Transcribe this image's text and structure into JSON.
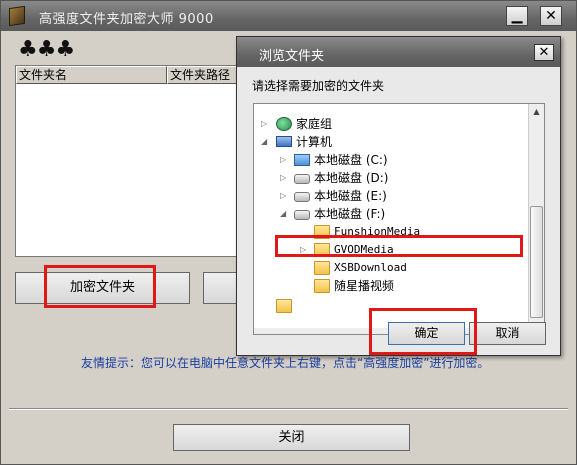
{
  "main": {
    "title": "高强度文件夹加密大师 9000",
    "minimize_glyph": "▁",
    "close_glyph": "✕",
    "logo_glyphs": "♣♣♣",
    "list_headers": [
      "文件夹名",
      "文件夹路径"
    ],
    "encrypt_button": "加密文件夹",
    "tip": "友情提示：您可以在电脑中任意文件夹上右键，点击“高强度加密”进行加密。",
    "close_button": "关闭"
  },
  "dialog": {
    "title": "浏览文件夹",
    "close_glyph": "✕",
    "prompt": "请选择需要加密的文件夹",
    "tree": [
      {
        "label": "家庭组",
        "icon": "homegroup-icon",
        "expander": "collapsed"
      },
      {
        "label": "计算机",
        "icon": "computer-icon",
        "expander": "expanded"
      },
      {
        "label": "本地磁盘 (C:)",
        "icon": "system-drive-icon",
        "expander": "collapsed"
      },
      {
        "label": "本地磁盘 (D:)",
        "icon": "drive-icon",
        "expander": "collapsed"
      },
      {
        "label": "本地磁盘 (E:)",
        "icon": "drive-icon",
        "expander": "collapsed"
      },
      {
        "label": "本地磁盘 (F:)",
        "icon": "drive-icon",
        "expander": "expanded"
      },
      {
        "label": "FunshionMedia",
        "icon": "folder-icon",
        "expander": "none"
      },
      {
        "label": "GVODMedia",
        "icon": "folder-icon",
        "expander": "collapsed"
      },
      {
        "label": "XSBDownload",
        "icon": "folder-icon",
        "expander": "none"
      },
      {
        "label": "随星播视频",
        "icon": "folder-icon",
        "expander": "none"
      }
    ],
    "ok_button": "确定",
    "cancel_button": "取消"
  }
}
